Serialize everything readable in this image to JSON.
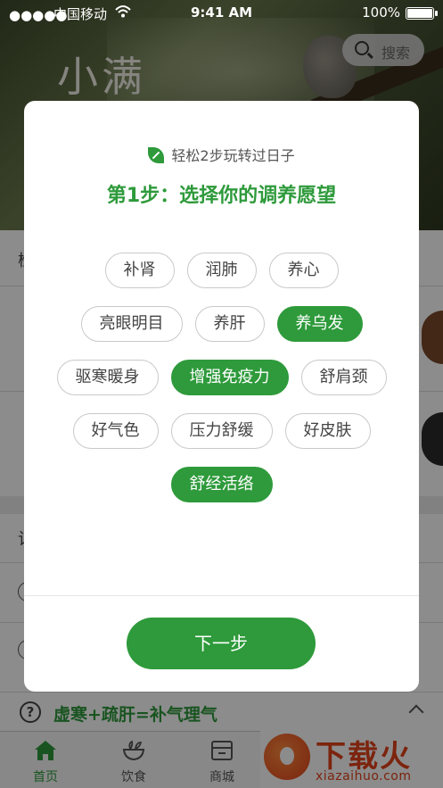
{
  "status_bar": {
    "carrier": "中国移动",
    "time": "9:41 AM",
    "battery": "100%"
  },
  "header": {
    "title": "小满",
    "search_placeholder": "搜索"
  },
  "background": {
    "section_peek_1": "检",
    "section_peek_2": "记",
    "advice_text": "虚寒+疏肝=补气理气",
    "advice_icon": "question-circle-icon"
  },
  "modal": {
    "hint": "轻松2步玩转过日子",
    "step_title": "第1步：选择你的调养愿望",
    "tag_rows": [
      [
        {
          "label": "补肾",
          "selected": false
        },
        {
          "label": "润肺",
          "selected": false
        },
        {
          "label": "养心",
          "selected": false
        }
      ],
      [
        {
          "label": "亮眼明目",
          "selected": false
        },
        {
          "label": "养肝",
          "selected": false
        },
        {
          "label": "养乌发",
          "selected": true
        }
      ],
      [
        {
          "label": "驱寒暖身",
          "selected": false
        },
        {
          "label": "增强免疫力",
          "selected": true
        },
        {
          "label": "舒肩颈",
          "selected": false
        }
      ],
      [
        {
          "label": "好气色",
          "selected": false
        },
        {
          "label": "压力舒缓",
          "selected": false
        },
        {
          "label": "好皮肤",
          "selected": false
        }
      ],
      [
        {
          "label": "舒经活络",
          "selected": true
        }
      ]
    ],
    "next_label": "下一步",
    "accent_color": "#2e9a3b"
  },
  "tabbar": {
    "items": [
      {
        "label": "首页",
        "icon": "home-icon",
        "active": true
      },
      {
        "label": "饮食",
        "icon": "bowl-icon",
        "active": false
      },
      {
        "label": "商城",
        "icon": "store-icon",
        "active": false
      }
    ]
  },
  "watermark": {
    "title": "下载火",
    "url": "xiazaihuo.com"
  }
}
